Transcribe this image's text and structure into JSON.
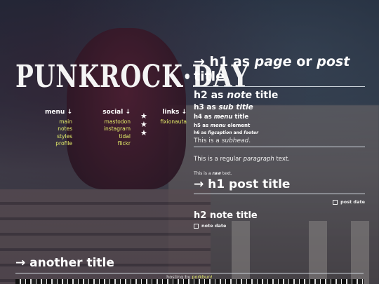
{
  "logo": {
    "text": "PUNKROCK·DAY",
    "stars": [
      "★",
      "★",
      "★"
    ]
  },
  "nav": {
    "menu": {
      "heading": "menu ↓",
      "items": [
        "main",
        "notes",
        "styles",
        "profile"
      ]
    },
    "social": {
      "heading": "social ↓",
      "items": [
        "mastodon",
        "instagram",
        "tidal",
        "flickr"
      ]
    },
    "links": {
      "heading": "links ↓",
      "items": [
        "fixionauta"
      ]
    }
  },
  "content": {
    "h1_prefix": "→ h1 as ",
    "h1_page": "page",
    "h1_or": " or ",
    "h1_post": "post",
    "h1_suffix": " title",
    "h2_prefix": "h2 as ",
    "h2_note": "note",
    "h2_suffix": " title",
    "h3_prefix": "h3 as ",
    "h3_sub": "sub title",
    "h4_prefix": "h4 as ",
    "h4_menu": "menu",
    "h4_suffix": " title",
    "h5_prefix": "h5 as ",
    "h5_menu": "menu",
    "h5_suffix": " element",
    "h6_prefix": "h6 as ",
    "h6_figcaption": "figcaption",
    "h6_and": " and ",
    "h6_footer": "footer",
    "subhead_prefix": "This is a ",
    "subhead_em": "subhead",
    "subhead_suffix": ".",
    "para_prefix": "This is a regular ",
    "para_em": "paragraph",
    "para_suffix": " text.",
    "raw_prefix": "This is a ",
    "raw_em": "raw",
    "raw_suffix": " text.",
    "post_title": "→ h1 post title",
    "post_date": "post date",
    "note_title": "h2 note title",
    "note_date": "note date",
    "another_title": "→ another title"
  },
  "footer": {
    "prefix": "hosting by ",
    "link": "porkbun!"
  },
  "colors": {
    "link_accent": "#e7ef6a",
    "rule": "#cfd6dd"
  }
}
